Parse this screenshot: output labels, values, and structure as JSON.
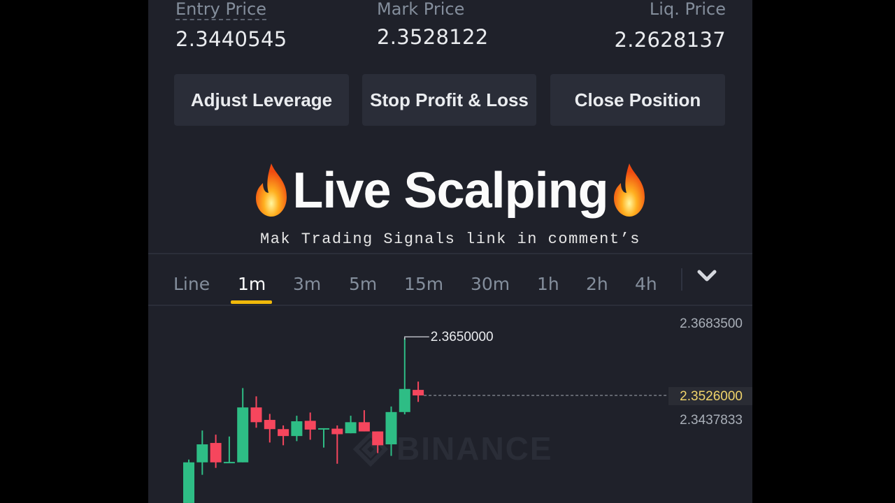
{
  "position": {
    "entry_price": {
      "label": "Entry Price",
      "value": "2.3440545"
    },
    "mark_price": {
      "label": "Mark Price",
      "value": "2.3528122"
    },
    "liq_price": {
      "label": "Liq. Price",
      "value": "2.2628137"
    }
  },
  "actions": {
    "adjust_leverage": "Adjust Leverage",
    "stop_profit_loss": "Stop Profit & Loss",
    "close_position": "Close Position"
  },
  "overlay": {
    "title": "Live Scalping",
    "emoji_icon": "fire-icon",
    "subtitle": "Mak Trading Signals link in comment’s"
  },
  "timeframes": {
    "items": [
      "Line",
      "1m",
      "3m",
      "5m",
      "15m",
      "30m",
      "1h",
      "2h",
      "4h"
    ],
    "active": "1m",
    "more_icon": "chevron-down-icon"
  },
  "colors": {
    "up": "#2ebd85",
    "down": "#f6465d",
    "accent": "#f0b90b",
    "current_price": "#f0d46b"
  },
  "chart_data": {
    "type": "candlestick",
    "interval": "1m",
    "watermark": "BINANCE",
    "y_axis_labels": [
      "2.3683500",
      "2.3526000",
      "2.3437833"
    ],
    "current_price": "2.3526000",
    "high_marker": "2.3650000",
    "ylim": [
      2.327,
      2.37
    ],
    "candles": [
      {
        "o": 2.3293,
        "h": 2.3387,
        "l": 2.327,
        "c": 2.3381
      },
      {
        "o": 2.3381,
        "h": 2.345,
        "l": 2.3354,
        "c": 2.342
      },
      {
        "o": 2.3423,
        "h": 2.3441,
        "l": 2.3369,
        "c": 2.3381
      },
      {
        "o": 2.3381,
        "h": 2.3437,
        "l": 2.3381,
        "c": 2.3382
      },
      {
        "o": 2.3381,
        "h": 2.3542,
        "l": 2.3381,
        "c": 2.35
      },
      {
        "o": 2.35,
        "h": 2.3524,
        "l": 2.3456,
        "c": 2.3468
      },
      {
        "o": 2.3473,
        "h": 2.3486,
        "l": 2.3424,
        "c": 2.3453
      },
      {
        "o": 2.3453,
        "h": 2.3461,
        "l": 2.3418,
        "c": 2.3438
      },
      {
        "o": 2.3438,
        "h": 2.3482,
        "l": 2.3427,
        "c": 2.347
      },
      {
        "o": 2.3471,
        "h": 2.3489,
        "l": 2.343,
        "c": 2.3452
      },
      {
        "o": 2.3454,
        "h": 2.3455,
        "l": 2.3413,
        "c": 2.3455
      },
      {
        "o": 2.3454,
        "h": 2.3461,
        "l": 2.3378,
        "c": 2.3442
      },
      {
        "o": 2.3444,
        "h": 2.3482,
        "l": 2.3444,
        "c": 2.3468
      },
      {
        "o": 2.3468,
        "h": 2.3494,
        "l": 2.3448,
        "c": 2.3448
      },
      {
        "o": 2.3448,
        "h": 2.3448,
        "l": 2.3401,
        "c": 2.3418
      },
      {
        "o": 2.342,
        "h": 2.3502,
        "l": 2.3395,
        "c": 2.349
      },
      {
        "o": 2.349,
        "h": 2.365,
        "l": 2.3485,
        "c": 2.354
      },
      {
        "o": 2.3538,
        "h": 2.3556,
        "l": 2.3512,
        "c": 2.3526
      }
    ]
  }
}
